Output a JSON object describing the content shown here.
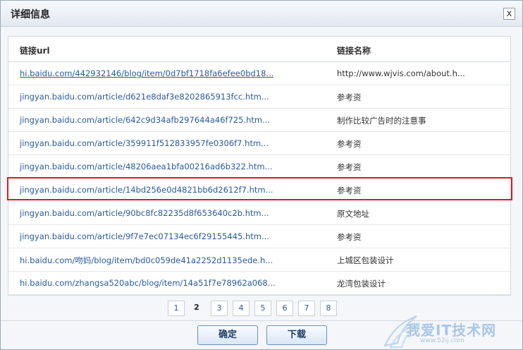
{
  "dialog": {
    "title": "详细信息",
    "close_label": "x"
  },
  "table": {
    "headers": {
      "url": "链接url",
      "name": "链接名称"
    },
    "rows": [
      {
        "url": "hi.baidu.com/442932146/blog/item/0d7bf1718fa6efee0bd18...",
        "name": "http://www.wjvis.com/about.h..."
      },
      {
        "url": "jingyan.baidu.com/article/d621e8daf3e8202865913fcc.htm...",
        "name": "参考资"
      },
      {
        "url": "jingyan.baidu.com/article/642c9d34afb297644a46f725.htm...",
        "name": "制作比较广告时的注意事"
      },
      {
        "url": "jingyan.baidu.com/article/359911f512833957fe0306f7.htm...",
        "name": "参考资"
      },
      {
        "url": "jingyan.baidu.com/article/48206aea1bfa00216ad6b322.htm...",
        "name": "参考资"
      },
      {
        "url": "jingyan.baidu.com/article/14bd256e0d4821bb6d2612f7.htm...",
        "name": "参考资"
      },
      {
        "url": "jingyan.baidu.com/article/90bc8fc82235d8f653640c2b.htm...",
        "name": "原文地址"
      },
      {
        "url": "jingyan.baidu.com/article/9f7e7ec07134ec6f29155445.htm...",
        "name": "参考资"
      },
      {
        "url": "hi.baidu.com/吻妈/blog/item/bd0c059de41a2252d1135ede.h...",
        "name": "上城区包装设计"
      },
      {
        "url": "hi.baidu.com/zhangsa520abc/blog/item/14a51f7e78962a068...",
        "name": "龙湾包装设计"
      }
    ]
  },
  "pagination": {
    "pages": [
      "1",
      "2",
      "3",
      "4",
      "5",
      "6",
      "7",
      "8"
    ],
    "current": "2"
  },
  "footer": {
    "confirm_label": "确定",
    "download_label": "下载"
  },
  "watermark": {
    "text": "我爱IT技术网",
    "url": "www.52ij.com"
  },
  "colors": {
    "highlight": "#d21f1f",
    "link": "#2a5a9a"
  }
}
